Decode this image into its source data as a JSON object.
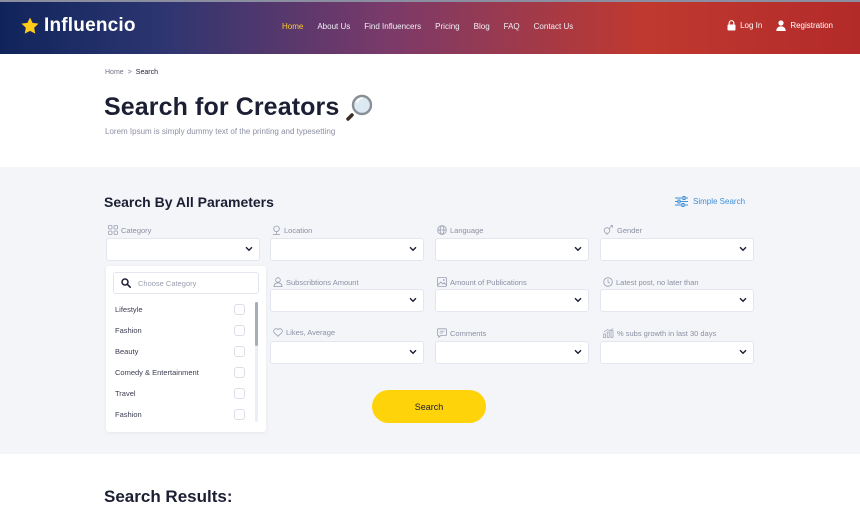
{
  "brand": {
    "name": "Influencio"
  },
  "nav": {
    "items": [
      {
        "label": "Home"
      },
      {
        "label": "About Us"
      },
      {
        "label": "Find Influencers"
      },
      {
        "label": "Pricing"
      },
      {
        "label": "Blog"
      },
      {
        "label": "FAQ"
      },
      {
        "label": "Contact Us"
      }
    ],
    "active": "Home",
    "active_color": "#ffcc2a"
  },
  "auth": {
    "login": "Log In",
    "register": "Registration"
  },
  "breadcrumb": {
    "home": "Home",
    "separator": ">",
    "current": "Search"
  },
  "page": {
    "title": "Search for Creators",
    "subtitle": "Lorem Ipsum is simply dummy text of the printing and typesetting"
  },
  "search": {
    "title": "Search By All Parameters",
    "simple_search": "Simple Search",
    "button": "Search",
    "fields": [
      {
        "label": "Category",
        "icon": "grid-icon"
      },
      {
        "label": "Location",
        "icon": "location-pin-icon"
      },
      {
        "label": "Language",
        "icon": "globe-icon"
      },
      {
        "label": "Gender",
        "icon": "gender-icon"
      },
      {
        "label": "Subscribtions Amount",
        "icon": "user-icon"
      },
      {
        "label": "Amount of Publications",
        "icon": "image-icon"
      },
      {
        "label": "Latest post, no later than",
        "icon": "clock-icon"
      },
      {
        "label": "Likes, Average",
        "icon": "heart-icon"
      },
      {
        "label": "Comments",
        "icon": "comment-icon"
      },
      {
        "label": "% subs growth  in last 30 days",
        "icon": "growth-chart-icon"
      }
    ],
    "category_dropdown": {
      "placeholder": "Choose Category",
      "options": [
        {
          "label": "Lifestyle",
          "checked": false
        },
        {
          "label": "Fashion",
          "checked": false
        },
        {
          "label": "Beauty",
          "checked": false
        },
        {
          "label": "Comedy & Entertainment",
          "checked": false
        },
        {
          "label": "Travel",
          "checked": false
        },
        {
          "label": "Fashion",
          "checked": false
        }
      ]
    },
    "button_color": "#ffd30a"
  },
  "results": {
    "title": "Search Results:"
  }
}
